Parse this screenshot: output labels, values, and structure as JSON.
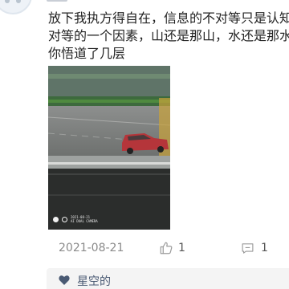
{
  "comment": {
    "lines": [
      "放下我执方得自在，信息的不对等只是认知不",
      "对等的一个因素，山还是那山，水还是那水，",
      "你悟道了几层"
    ]
  },
  "photo": {
    "stamp_line_1": "2021-08-21",
    "stamp_line_2": "AI DUAL CAMERA"
  },
  "meta": {
    "date": "2021-08-21",
    "like_count": "1",
    "reply_count": "1"
  },
  "likes": {
    "names": "星空的"
  },
  "icons": {
    "like": "thumbs-up-icon",
    "reply": "comment-icon",
    "heart": "heart-icon"
  },
  "colors": {
    "text": "#222222",
    "meta": "#8a8a8a",
    "liker": "#4a5a73",
    "heart": "#4a5a73"
  }
}
